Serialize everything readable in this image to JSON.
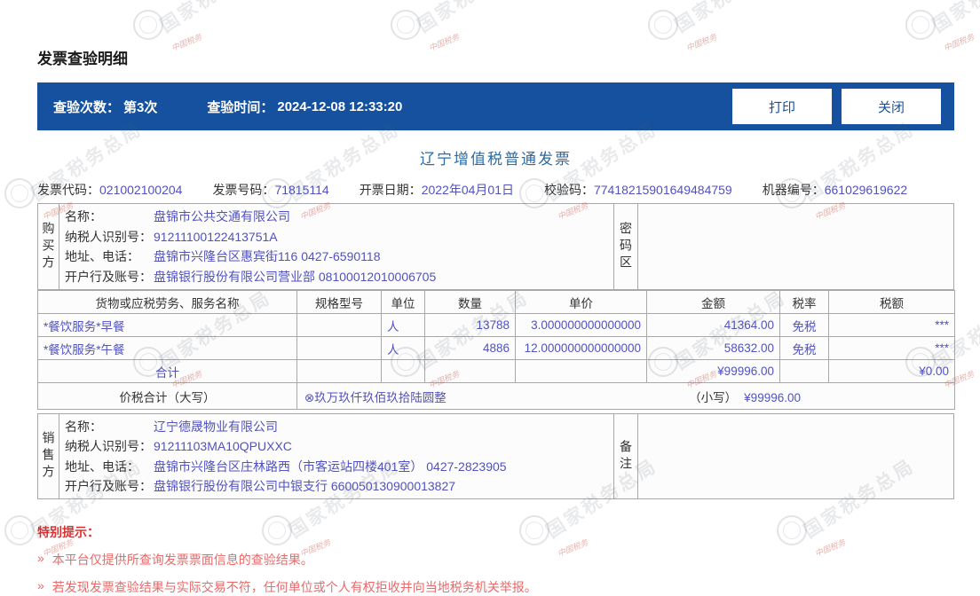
{
  "watermark": {
    "text": "国家税务总局",
    "seal_text": "中国税务"
  },
  "page": {
    "title": "发票查验明细"
  },
  "header_bar": {
    "check_count_label": "查验次数：",
    "check_count_value": "第3次",
    "check_time_label": "查验时间：",
    "check_time_value": "2024-12-08 12:33:20",
    "print_button": "打印",
    "close_button": "关闭"
  },
  "invoice": {
    "title": "辽宁增值税普通发票",
    "meta": {
      "code_label": "发票代码：",
      "code": "021002100204",
      "number_label": "发票号码：",
      "number": "71815114",
      "date_label": "开票日期：",
      "date": "2022年04月01日",
      "checksum_label": "校验码：",
      "checksum": "77418215901649484759",
      "machine_label": "机器编号：",
      "machine": "661029619622"
    },
    "buyer": {
      "side_label": "购买方",
      "right_label": "密码区",
      "rows": [
        {
          "label": "名称：",
          "value": "盘锦市公共交通有限公司"
        },
        {
          "label": "纳税人识别号：",
          "value": "91211100122413751A"
        },
        {
          "label": "地址、电话：",
          "value": "盘锦市兴隆台区惠宾街116 0427-6590118"
        },
        {
          "label": "开户行及账号：",
          "value": "盘锦银行股份有限公司营业部 08100012010006705"
        }
      ]
    },
    "items_table": {
      "headers": [
        "货物或应税劳务、服务名称",
        "规格型号",
        "单位",
        "数量",
        "单价",
        "金额",
        "税率",
        "税额"
      ],
      "rows": [
        {
          "name": "*餐饮服务*早餐",
          "spec": "",
          "unit": "人",
          "qty": "13788",
          "price": "3.000000000000000",
          "amount": "41364.00",
          "tax_rate": "免税",
          "tax": "***"
        },
        {
          "name": "*餐饮服务*午餐",
          "spec": "",
          "unit": "人",
          "qty": "4886",
          "price": "12.000000000000000",
          "amount": "58632.00",
          "tax_rate": "免税",
          "tax": "***"
        }
      ],
      "total": {
        "label": "合计",
        "amount": "¥99996.00",
        "tax": "¥0.00"
      }
    },
    "total_row": {
      "label": "价税合计（大写）",
      "amount_words": "⊗玖万玖仟玖佰玖拾陆圆整",
      "small_label": "（小写）",
      "amount_figures": "¥99996.00"
    },
    "seller": {
      "side_label": "销售方",
      "right_label": "备注",
      "rows": [
        {
          "label": "名称：",
          "value": "辽宁德晟物业有限公司"
        },
        {
          "label": "纳税人识别号：",
          "value": "91211103MA10QPUXXC"
        },
        {
          "label": "地址、电话：",
          "value": "盘锦市兴隆台区庄林路西（市客运站四楼401室） 0427-2823905"
        },
        {
          "label": "开户行及账号：",
          "value": "盘锦银行股份有限公司中银支行 660050130900013827"
        }
      ]
    }
  },
  "notice": {
    "title": "特别提示：",
    "bullet_icon": "»",
    "items": [
      "本平台仅提供所查询发票票面信息的查验结果。",
      "若发现发票查验结果与实际交易不符，任何单位或个人有权拒收并向当地税务机关举报。"
    ]
  },
  "colors": {
    "header_bar_blue": "#15519e",
    "value_blue_violet": "#5152be",
    "invoice_title_blue": "#2b6ba8",
    "notice_red": "#e02f2f",
    "notice_item_red": "#e86a6a",
    "table_border_gray": "#a8a8a8"
  }
}
